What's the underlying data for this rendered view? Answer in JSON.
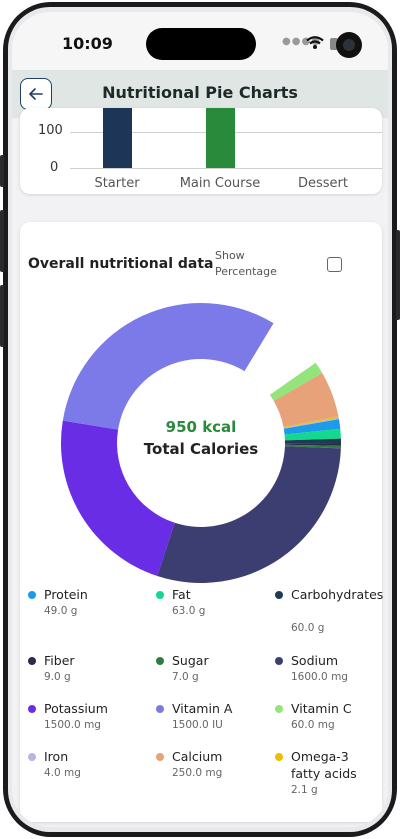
{
  "status": {
    "time": "10:09"
  },
  "header": {
    "title": "Nutritional Pie Charts",
    "back_icon": "arrow-left-icon"
  },
  "colors": {
    "accent": "#1f3f66",
    "kcal": "#2a8a3b",
    "header_bg": "#dfe6e4"
  },
  "bar_chart": {
    "chart_data": {
      "type": "bar",
      "categories": [
        "Starter",
        "Main Course",
        "Dessert"
      ],
      "visible_ticks": [
        "100",
        "0"
      ],
      "colors": [
        "#1d3557",
        "#2a8a3b",
        "#cccccc"
      ]
    }
  },
  "pie": {
    "title": "Overall nutritional data",
    "show_percentage_label": "Show Percentage",
    "center_value": "950 kcal",
    "center_label": "Total Calories"
  },
  "chart_data": {
    "type": "pie",
    "total_calories": "950 kcal",
    "slices": [
      {
        "name": "Protein",
        "value": "49.0 g",
        "color": "#1e9be8"
      },
      {
        "name": "Fat",
        "value": "63.0 g",
        "color": "#12d98e"
      },
      {
        "name": "Carbohydrates",
        "value": "60.0 g",
        "color": "#1d3b52"
      },
      {
        "name": "Fiber",
        "value": "9.0 g",
        "color": "#2a2a4a"
      },
      {
        "name": "Sugar",
        "value": "7.0 g",
        "color": "#2f7d43"
      },
      {
        "name": "Sodium",
        "value": "1600.0 mg",
        "color": "#3c3e72"
      },
      {
        "name": "Potassium",
        "value": "1500.0 mg",
        "color": "#6a2de6"
      },
      {
        "name": "Vitamin A",
        "value": "1500.0 IU",
        "color": "#7b7ae8"
      },
      {
        "name": "Vitamin C",
        "value": "60.0 mg",
        "color": "#93e57b"
      },
      {
        "name": "Iron",
        "value": "4.0 mg",
        "color": "#b9b4e4"
      },
      {
        "name": "Calcium",
        "value": "250.0 mg",
        "color": "#e8a27a"
      },
      {
        "name": "Omega-3 fatty acids",
        "value": "2.1 g",
        "color": "#e8c000"
      }
    ]
  }
}
